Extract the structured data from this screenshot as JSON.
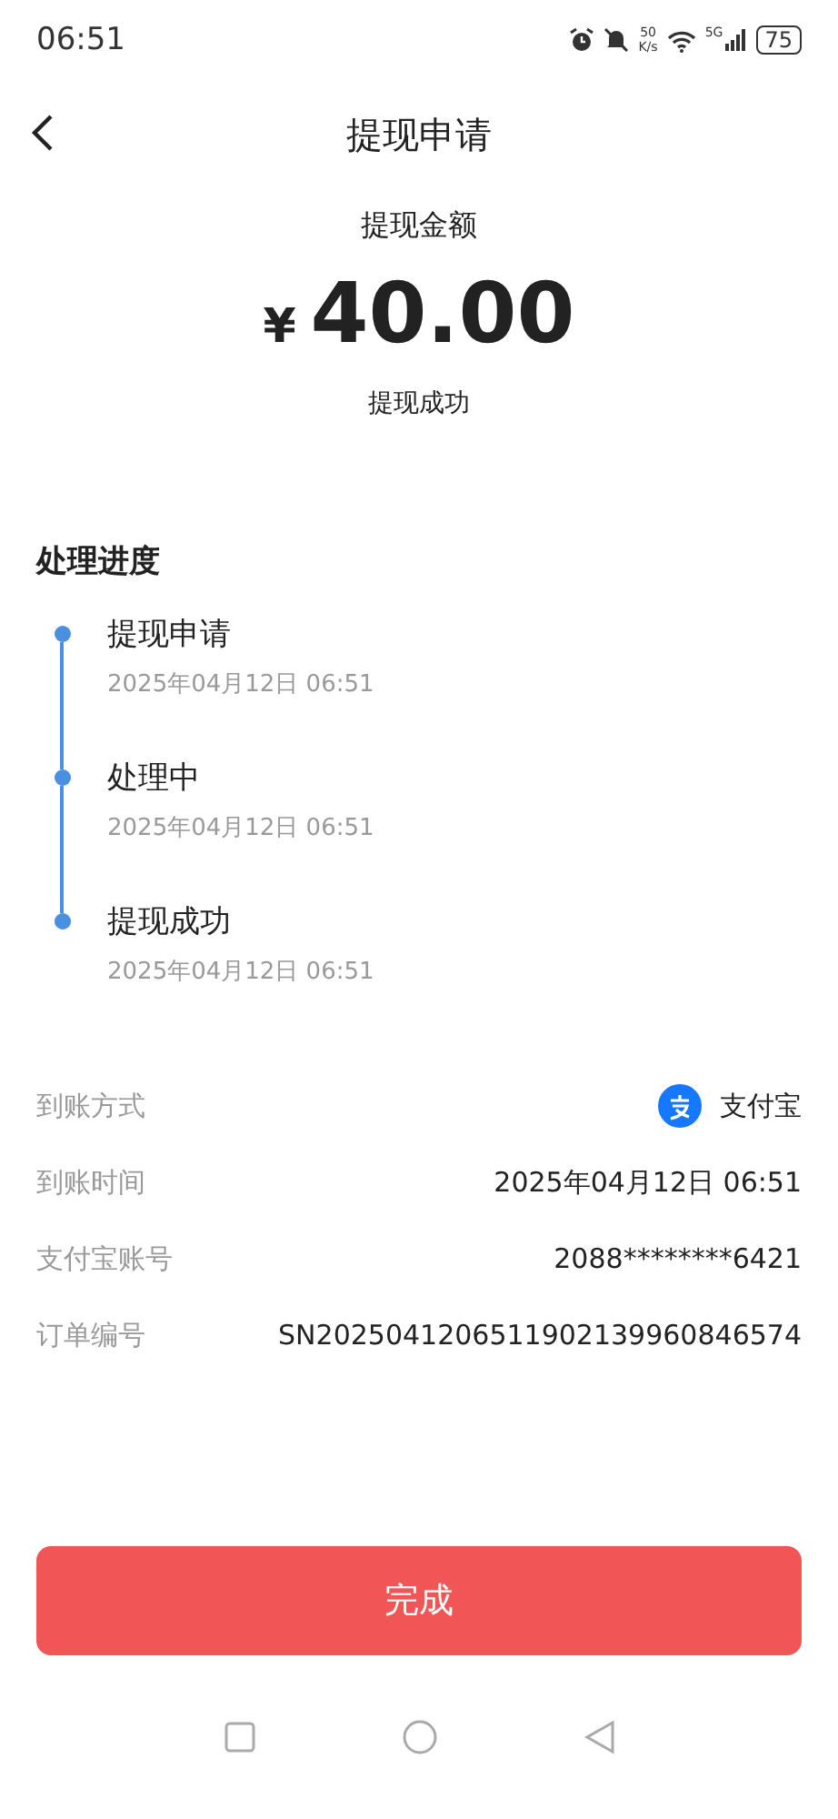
{
  "status_bar": {
    "time": "06:51",
    "speed_value": "50",
    "speed_unit": "K/s",
    "network": "5G",
    "battery": "75"
  },
  "header": {
    "title": "提现申请"
  },
  "amount": {
    "label": "提现金额",
    "currency": "¥",
    "value": "40.00",
    "status": "提现成功"
  },
  "progress": {
    "title": "处理进度",
    "steps": [
      {
        "name": "提现申请",
        "time": "2025年04月12日 06:51"
      },
      {
        "name": "处理中",
        "time": "2025年04月12日 06:51"
      },
      {
        "name": "提现成功",
        "time": "2025年04月12日 06:51"
      }
    ]
  },
  "details": [
    {
      "kind": "method",
      "label": "到账方式",
      "value": "支付宝"
    },
    {
      "kind": "text",
      "label": "到账时间",
      "value": "2025年04月12日 06:51"
    },
    {
      "kind": "text",
      "label": "支付宝账号",
      "value": "2088********6421"
    },
    {
      "kind": "text",
      "label": "订单编号",
      "value": "SN2025041206511902139960846574"
    }
  ],
  "done_button": "完成"
}
